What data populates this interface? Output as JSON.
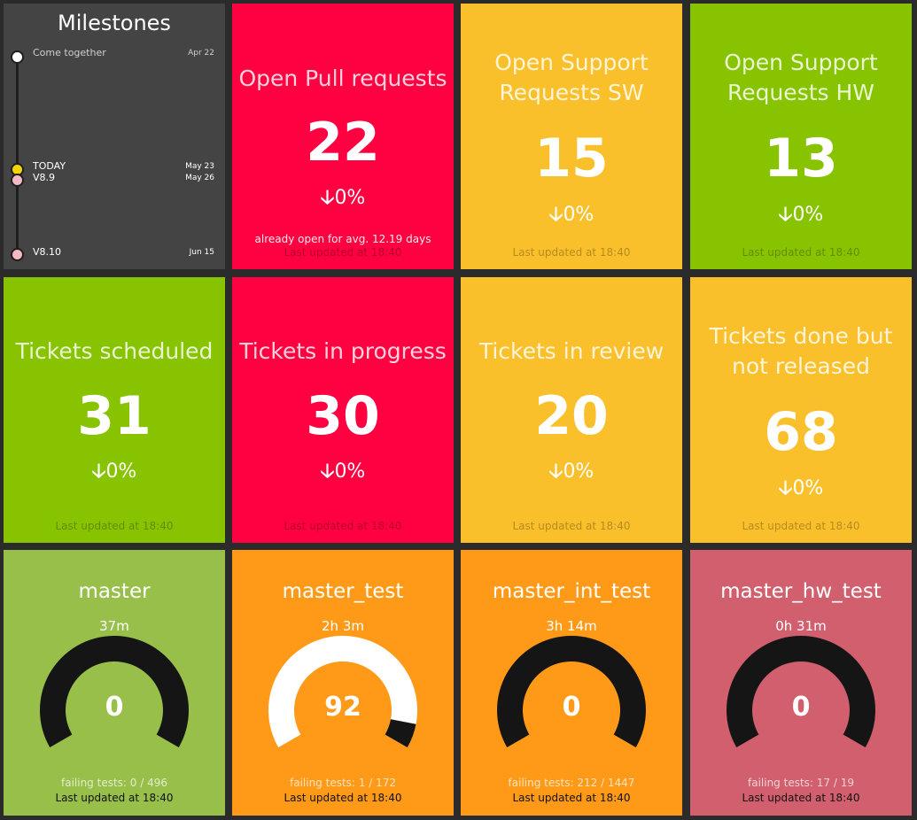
{
  "milestones": {
    "title": "Milestones",
    "items": [
      {
        "label": "Come together",
        "date": "Apr 22",
        "color": "#ffffff"
      },
      {
        "label": "TODAY",
        "date": "May 23",
        "color": "#f6d400"
      },
      {
        "label": "V8.9",
        "date": "May 26",
        "color": "#f4b9c4"
      },
      {
        "label": "V8.10",
        "date": "Jun 15",
        "color": "#f4b9c4"
      }
    ]
  },
  "number_tiles": [
    {
      "title": "Open Pull requests",
      "value": "22",
      "change": "0%",
      "more_info": "already open for avg. 12.19 days",
      "updated": "Last updated at 18:40",
      "color": "#ff0040"
    },
    {
      "title": "Open Support Requests SW",
      "value": "15",
      "change": "0%",
      "updated": "Last updated at 18:40",
      "color": "#fac02b"
    },
    {
      "title": "Open Support Requests HW",
      "value": "13",
      "change": "0%",
      "updated": "Last updated at 18:40",
      "color": "#88c300"
    },
    {
      "title": "Tickets scheduled",
      "value": "31",
      "change": "0%",
      "updated": "Last updated at 18:40",
      "color": "#88c300"
    },
    {
      "title": "Tickets in progress",
      "value": "30",
      "change": "0%",
      "updated": "Last updated at 18:40",
      "color": "#ff0040"
    },
    {
      "title": "Tickets in review",
      "value": "20",
      "change": "0%",
      "updated": "Last updated at 18:40",
      "color": "#fac02b"
    },
    {
      "title": "Tickets done but not released",
      "value": "68",
      "change": "0%",
      "updated": "Last updated at 18:40",
      "color": "#fac02b"
    }
  ],
  "meter_tiles": [
    {
      "title": "master",
      "time": "37m",
      "value": "0",
      "level": 0,
      "failing": "failing tests: 0 / 496",
      "updated": "Last updated at 18:40",
      "color": "#97bf4a"
    },
    {
      "title": "master_test",
      "time": "2h 3m",
      "value": "92",
      "level": 92,
      "failing": "failing tests: 1 / 172",
      "updated": "Last updated at 18:40",
      "color": "#ff9a19"
    },
    {
      "title": "master_int_test",
      "time": "3h 14m",
      "value": "0",
      "level": 0,
      "failing": "failing tests: 212 / 1447",
      "updated": "Last updated at 18:40",
      "color": "#ff9a19"
    },
    {
      "title": "master_hw_test",
      "time": "0h 31m",
      "value": "0",
      "level": 0,
      "failing": "failing tests: 17 / 19",
      "updated": "Last updated at 18:40",
      "color": "#d25f6e"
    }
  ]
}
